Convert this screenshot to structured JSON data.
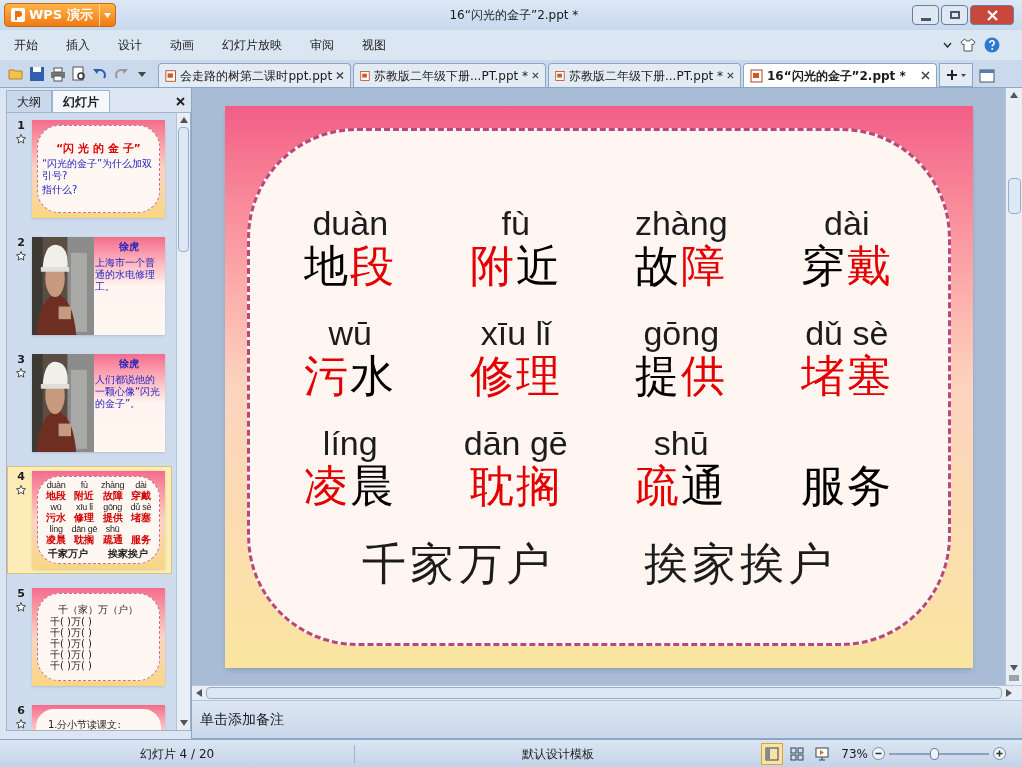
{
  "app_button": {
    "label": "WPS 演示"
  },
  "window": {
    "title": "16“闪光的金子”2.ppt *"
  },
  "menu": [
    {
      "label": "开始"
    },
    {
      "label": "插入"
    },
    {
      "label": "设计"
    },
    {
      "label": "动画"
    },
    {
      "label": "幻灯片放映"
    },
    {
      "label": "审阅"
    },
    {
      "label": "视图"
    }
  ],
  "doc_tabs": [
    {
      "label": "会走路的树第二课时ppt.ppt",
      "selected": false
    },
    {
      "label": "苏教版二年级下册...PT.ppt *",
      "selected": false
    },
    {
      "label": "苏教版二年级下册...PT.ppt *",
      "selected": false
    },
    {
      "label": "16“闪光的金子”2.ppt *",
      "selected": true
    }
  ],
  "panel_tabs": [
    {
      "label": "大纲",
      "selected": false
    },
    {
      "label": "幻灯片",
      "selected": true
    }
  ],
  "thumbnails": [
    {
      "number": "1",
      "kind": "title",
      "selected": false,
      "title": "“闪 光 的 金 子”",
      "lines": [
        "“闪光的金子”为什么加双引号?",
        "指什么?"
      ]
    },
    {
      "number": "2",
      "selected": false,
      "title": "徐虎",
      "lines": [
        "上海市一个普通的水电修理工。"
      ]
    },
    {
      "number": "3",
      "selected": false,
      "title": "徐虎",
      "lines": [
        "人们都说他的一颗心像“闪光的金子”。"
      ]
    },
    {
      "number": "4",
      "kind": "words",
      "selected": true,
      "rows": [
        [
          "duàn",
          "地段",
          "fù",
          "附近",
          "zhàng",
          "故障",
          "dài",
          "穿戴"
        ],
        [
          "wū",
          "污水",
          "xīu lǐ",
          "修理",
          "gōng",
          "提供",
          "dǔ sè",
          "堵塞"
        ],
        [
          "líng",
          "凌晨",
          "dān gē",
          "耽搁",
          "shū",
          "疏通",
          "",
          "服务"
        ]
      ],
      "lines": [
        "千家万户",
        "挨家挨户"
      ]
    },
    {
      "number": "5",
      "kind": "list",
      "selected": false,
      "title": "千（家）万（户）",
      "lines": [
        "千(  )万(  )",
        "千(  )万(  )",
        "千(  )万(  )",
        "千(  )万(  )",
        "千(  )万(  )"
      ]
    },
    {
      "number": "6",
      "kind": "text",
      "selected": false,
      "lines": [
        "1.分小节读课文:"
      ]
    }
  ],
  "slide": {
    "rows": [
      [
        {
          "pinyin": "duàn",
          "parts": [
            {
              "text": "地",
              "highlight": false
            },
            {
              "text": "段",
              "highlight": true
            }
          ]
        },
        {
          "pinyin": "fù",
          "parts": [
            {
              "text": "附",
              "highlight": true
            },
            {
              "text": "近",
              "highlight": false
            }
          ]
        },
        {
          "pinyin": "zhàng",
          "parts": [
            {
              "text": "故",
              "highlight": false
            },
            {
              "text": "障",
              "highlight": true
            }
          ]
        },
        {
          "pinyin": "dài",
          "parts": [
            {
              "text": "穿",
              "highlight": false
            },
            {
              "text": "戴",
              "highlight": true
            }
          ]
        }
      ],
      [
        {
          "pinyin": "wū",
          "parts": [
            {
              "text": "污",
              "highlight": true
            },
            {
              "text": "水",
              "highlight": false
            }
          ]
        },
        {
          "pinyin": "xīu lǐ",
          "parts": [
            {
              "text": "修理",
              "highlight": true
            }
          ]
        },
        {
          "pinyin": "gōng",
          "parts": [
            {
              "text": "提",
              "highlight": false
            },
            {
              "text": "供",
              "highlight": true
            }
          ]
        },
        {
          "pinyin": "dǔ sè",
          "parts": [
            {
              "text": "堵塞",
              "highlight": true
            }
          ]
        }
      ],
      [
        {
          "pinyin": "líng",
          "parts": [
            {
              "text": "凌",
              "highlight": true
            },
            {
              "text": "晨",
              "highlight": false
            }
          ]
        },
        {
          "pinyin": "dān gē",
          "parts": [
            {
              "text": "耽搁",
              "highlight": true
            }
          ]
        },
        {
          "pinyin": "shū",
          "parts": [
            {
              "text": "疏",
              "highlight": true
            },
            {
              "text": "通",
              "highlight": false
            }
          ]
        },
        {
          "parts": [
            {
              "text": "服务",
              "highlight": false
            }
          ]
        }
      ]
    ],
    "idioms": [
      "千家万户",
      "挨家挨户"
    ]
  },
  "notes": {
    "placeholder": "单击添加备注"
  },
  "status_bar": {
    "slide_counter": "幻灯片 4 / 20",
    "template": "默认设计模板",
    "views": [
      {
        "kind": "normal",
        "selected": true
      },
      {
        "kind": "sorter",
        "selected": false
      },
      {
        "kind": "show",
        "selected": false
      }
    ],
    "zoom": "73%",
    "zoom_slider": {
      "level": 0.45
    }
  }
}
